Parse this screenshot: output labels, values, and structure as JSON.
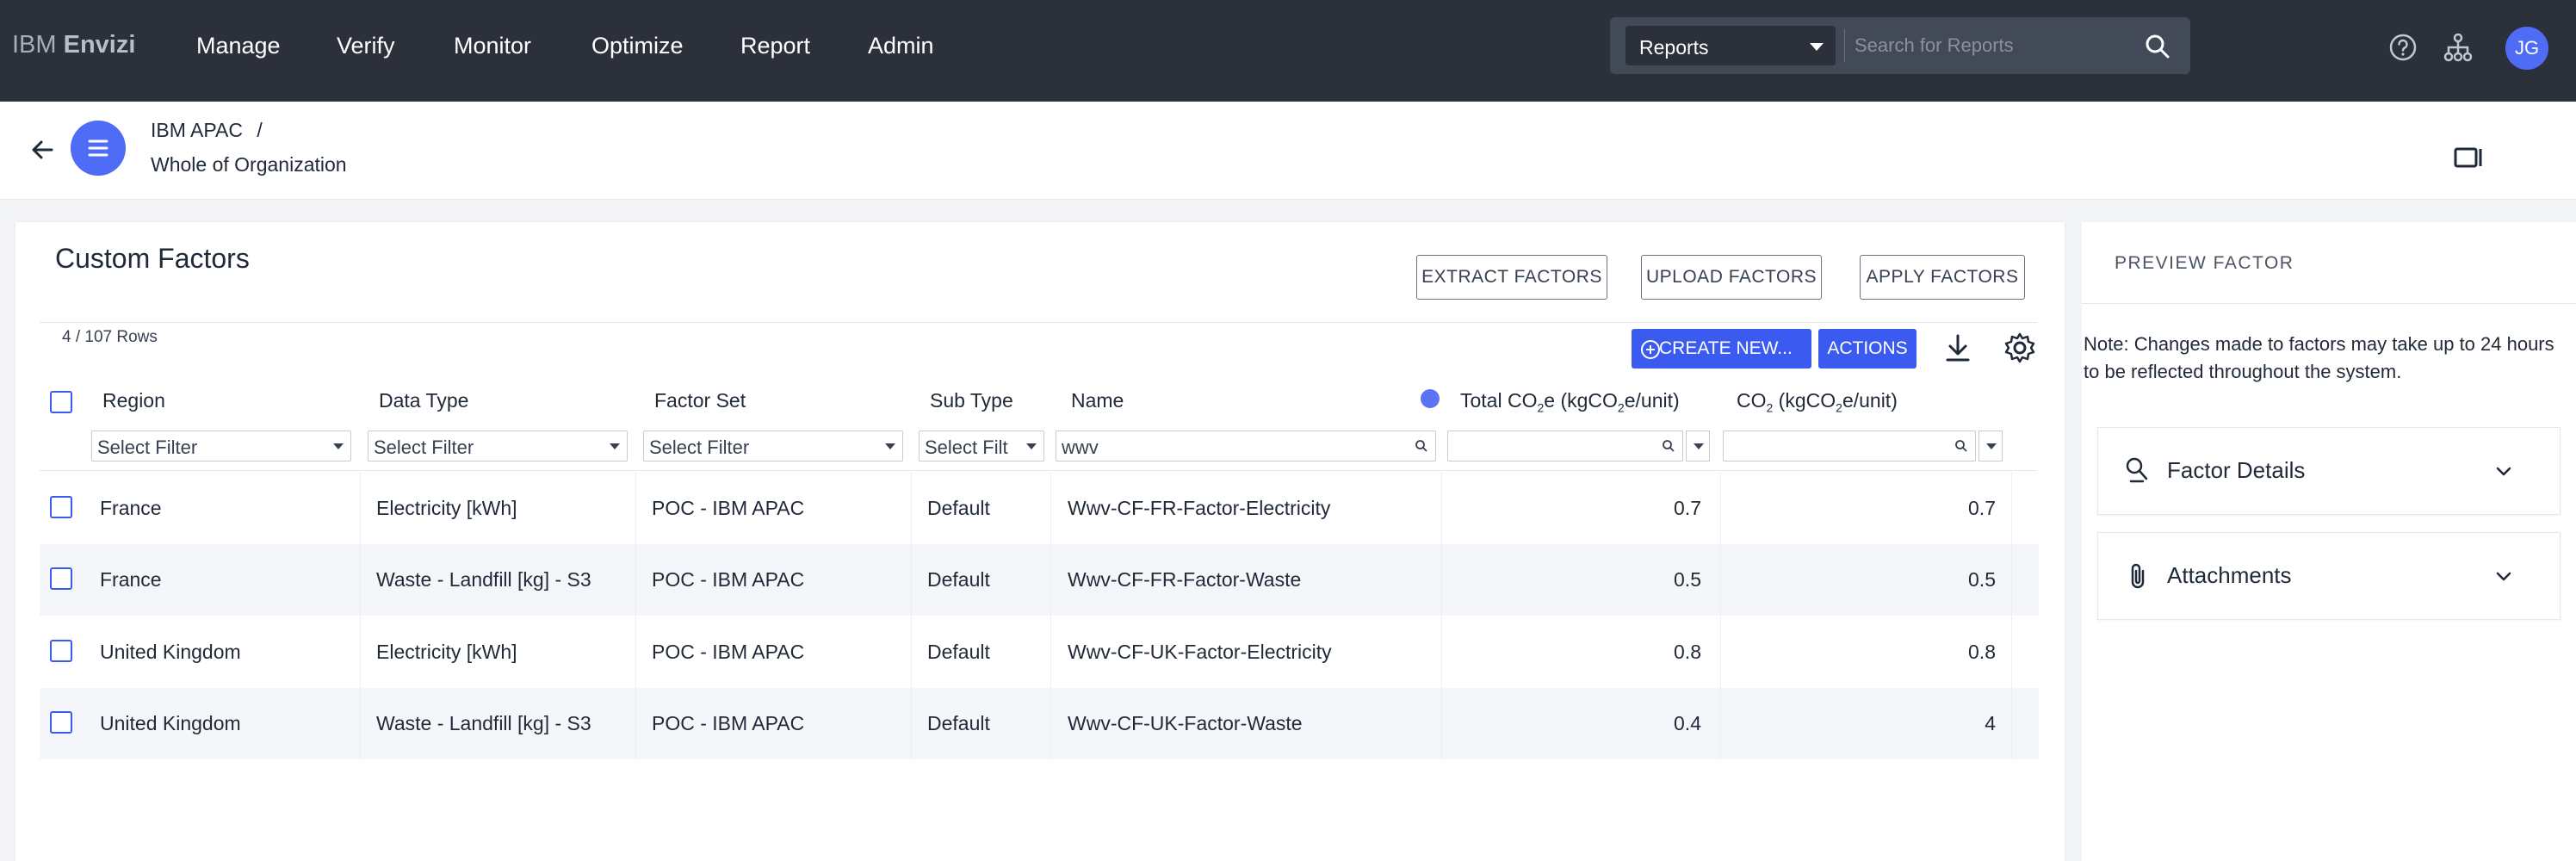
{
  "topbar": {
    "brand_prefix": "IBM",
    "brand_name": "Envizi",
    "nav": [
      "Manage",
      "Verify",
      "Monitor",
      "Optimize",
      "Report",
      "Admin"
    ],
    "search_scope": "Reports",
    "search_placeholder": "Search for Reports",
    "avatar_initials": "JG"
  },
  "header": {
    "crumb_org": "IBM APAC",
    "crumb_sep": "/",
    "crumb_scope": "Whole of Organization"
  },
  "main": {
    "title": "Custom Factors",
    "buttons": {
      "extract": "EXTRACT FACTORS",
      "upload": "UPLOAD FACTORS",
      "apply": "APPLY FACTORS",
      "create": "CREATE NEW...",
      "actions": "ACTIONS"
    },
    "rows_count": "4 / 107 Rows",
    "columns": {
      "region": "Region",
      "data_type": "Data Type",
      "factor_set": "Factor Set",
      "sub_type": "Sub Type",
      "name": "Name",
      "total_co2e_a": "Total CO",
      "total_co2e_sub1": "2",
      "total_co2e_b": "e (kgCO",
      "total_co2e_sub2": "2",
      "total_co2e_c": "e/unit)",
      "co2_a": "CO",
      "co2_sub1": "2",
      "co2_b": " (kgCO",
      "co2_sub2": "2",
      "co2_c": "e/unit)"
    },
    "filters": {
      "region": "Select Filter",
      "data_type": "Select Filter",
      "factor_set": "Select Filter",
      "sub_type": "Select Filt",
      "name": "wwv",
      "total_co2e": "",
      "co2": ""
    },
    "rows": [
      {
        "region": "France",
        "data_type": "Electricity [kWh]",
        "factor_set": "POC - IBM APAC",
        "sub_type": "Default",
        "name": "Wwv-CF-FR-Factor-Electricity",
        "total_co2e": "0.7",
        "co2": "0.7"
      },
      {
        "region": "France",
        "data_type": "Waste - Landfill [kg] - S3",
        "factor_set": "POC - IBM APAC",
        "sub_type": "Default",
        "name": "Wwv-CF-FR-Factor-Waste",
        "total_co2e": "0.5",
        "co2": "0.5"
      },
      {
        "region": "United Kingdom",
        "data_type": "Electricity [kWh]",
        "factor_set": "POC - IBM APAC",
        "sub_type": "Default",
        "name": "Wwv-CF-UK-Factor-Electricity",
        "total_co2e": "0.8",
        "co2": "0.8"
      },
      {
        "region": "United Kingdom",
        "data_type": "Waste - Landfill [kg] - S3",
        "factor_set": "POC - IBM APAC",
        "sub_type": "Default",
        "name": "Wwv-CF-UK-Factor-Waste",
        "total_co2e": "0.4",
        "co2": "4"
      }
    ]
  },
  "preview": {
    "title": "PREVIEW FACTOR",
    "note": "Note: Changes made to factors may take up to 24 hours to be reflected throughout the system.",
    "sections": [
      "Factor Details",
      "Attachments"
    ]
  },
  "colors": {
    "topbar_bg": "#2b303b",
    "accent": "#3b5bf0",
    "avatar": "#4f6cf7"
  }
}
